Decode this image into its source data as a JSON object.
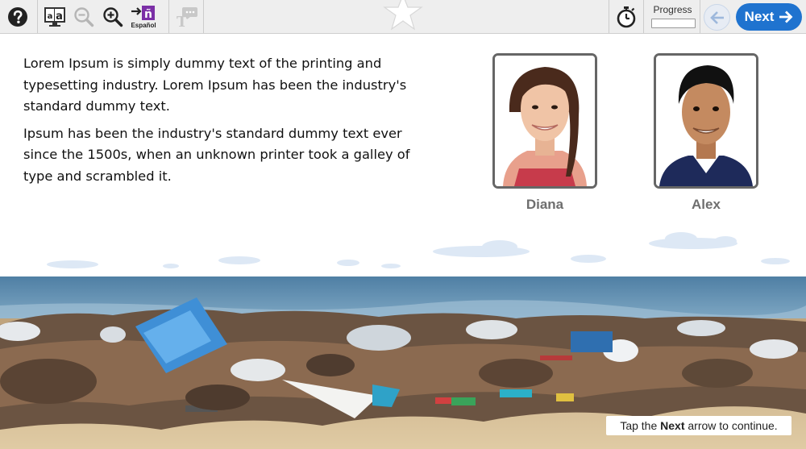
{
  "toolbar": {
    "help_icon": "question-circle-icon",
    "text_size_icon": "text-size-icon",
    "zoom_out_icon": "zoom-out-icon",
    "zoom_in_icon": "zoom-in-icon",
    "language_label": "Español",
    "language_icon": "translate-enye-icon",
    "tts_icon": "text-to-speech-icon",
    "timer_icon": "stopwatch-icon",
    "progress_label": "Progress",
    "progress_value": 0,
    "back_icon": "arrow-left-icon",
    "next_label": "Next",
    "next_icon": "arrow-right-icon"
  },
  "content": {
    "paragraphs": [
      "Lorem Ipsum is simply dummy text of the printing and typesetting industry. Lorem Ipsum has been the industry's standard dummy text.",
      "Ipsum has been the industry's standard dummy text ever since the 1500s, when an unknown printer took a galley of type and scrambled it."
    ]
  },
  "characters": [
    {
      "name": "Diana"
    },
    {
      "name": "Alex"
    }
  ],
  "hint": {
    "before": "Tap the ",
    "bold": "Next",
    "after": " arrow to continue."
  },
  "colors": {
    "accent": "#1f73cf",
    "toolbar_bg": "#eeeeee",
    "name_text": "#6e6e6e",
    "card_border": "#666666",
    "language_badge": "#7b2fa6"
  }
}
